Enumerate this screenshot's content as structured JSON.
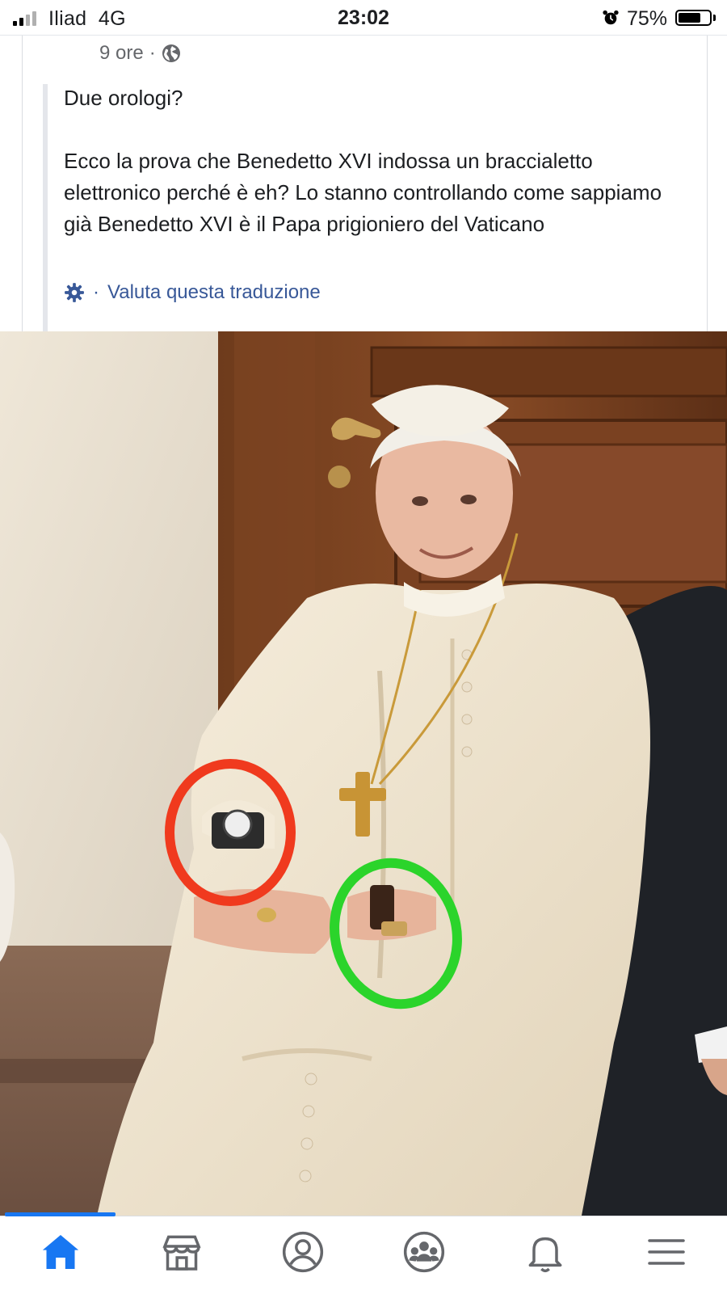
{
  "status_bar": {
    "carrier": "Iliad",
    "network": "4G",
    "time": "23:02",
    "battery_percent": "75%",
    "battery_level": 0.75,
    "icons": [
      "signal-icon",
      "alarm-icon",
      "battery-icon"
    ]
  },
  "post": {
    "timestamp": "9 ore",
    "separator": "·",
    "privacy_icon": "globe-icon",
    "title": "Due orologi?",
    "body": "Ecco la prova che Benedetto XVI indossa un braccialetto elettronico perché è eh? Lo stanno controllando come sappiamo già Benedetto XVI è il Papa prigioniero del Vaticano",
    "translation_icon": "gear-icon",
    "translation_separator": "·",
    "rate_translation": "Valuta questa traduzione"
  },
  "photo": {
    "circle_colors": {
      "red": "#f03a1e",
      "green": "#2bd42b"
    }
  },
  "bottom_nav": {
    "accent": "#1877f2",
    "items": [
      {
        "icon": "home-icon",
        "active": true
      },
      {
        "icon": "marketplace-icon",
        "active": false
      },
      {
        "icon": "profile-icon",
        "active": false
      },
      {
        "icon": "groups-icon",
        "active": false
      },
      {
        "icon": "bell-icon",
        "active": false
      },
      {
        "icon": "menu-icon",
        "active": false
      }
    ]
  }
}
